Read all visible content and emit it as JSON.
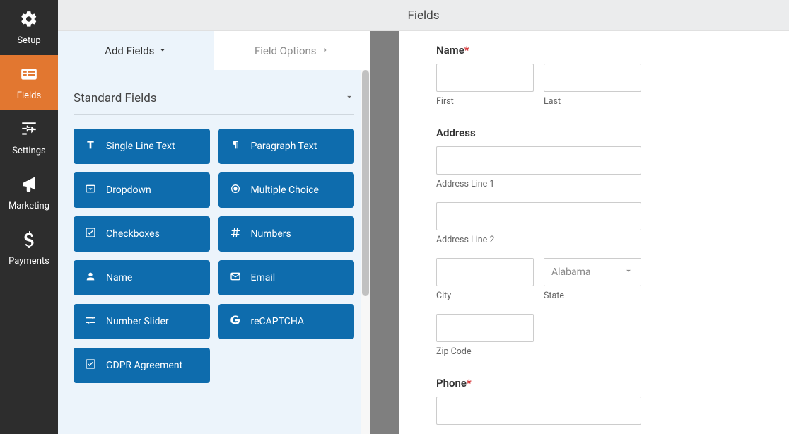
{
  "page_title": "Fields",
  "nav": {
    "setup": "Setup",
    "fields": "Fields",
    "settings": "Settings",
    "marketing": "Marketing",
    "payments": "Payments"
  },
  "tabs": {
    "add_fields": "Add Fields",
    "field_options": "Field Options"
  },
  "group": {
    "standard": "Standard Fields"
  },
  "field_buttons": {
    "single_line": "Single Line Text",
    "paragraph": "Paragraph Text",
    "dropdown": "Dropdown",
    "multiple_choice": "Multiple Choice",
    "checkboxes": "Checkboxes",
    "numbers": "Numbers",
    "name": "Name",
    "email": "Email",
    "number_slider": "Number Slider",
    "recaptcha": "reCAPTCHA",
    "gdpr": "GDPR Agreement"
  },
  "preview": {
    "name_label": "Name",
    "first": "First",
    "last": "Last",
    "address_label": "Address",
    "addr1": "Address Line 1",
    "addr2": "Address Line 2",
    "city": "City",
    "state": "State",
    "state_value": "Alabama",
    "zip": "Zip Code",
    "phone_label": "Phone"
  }
}
